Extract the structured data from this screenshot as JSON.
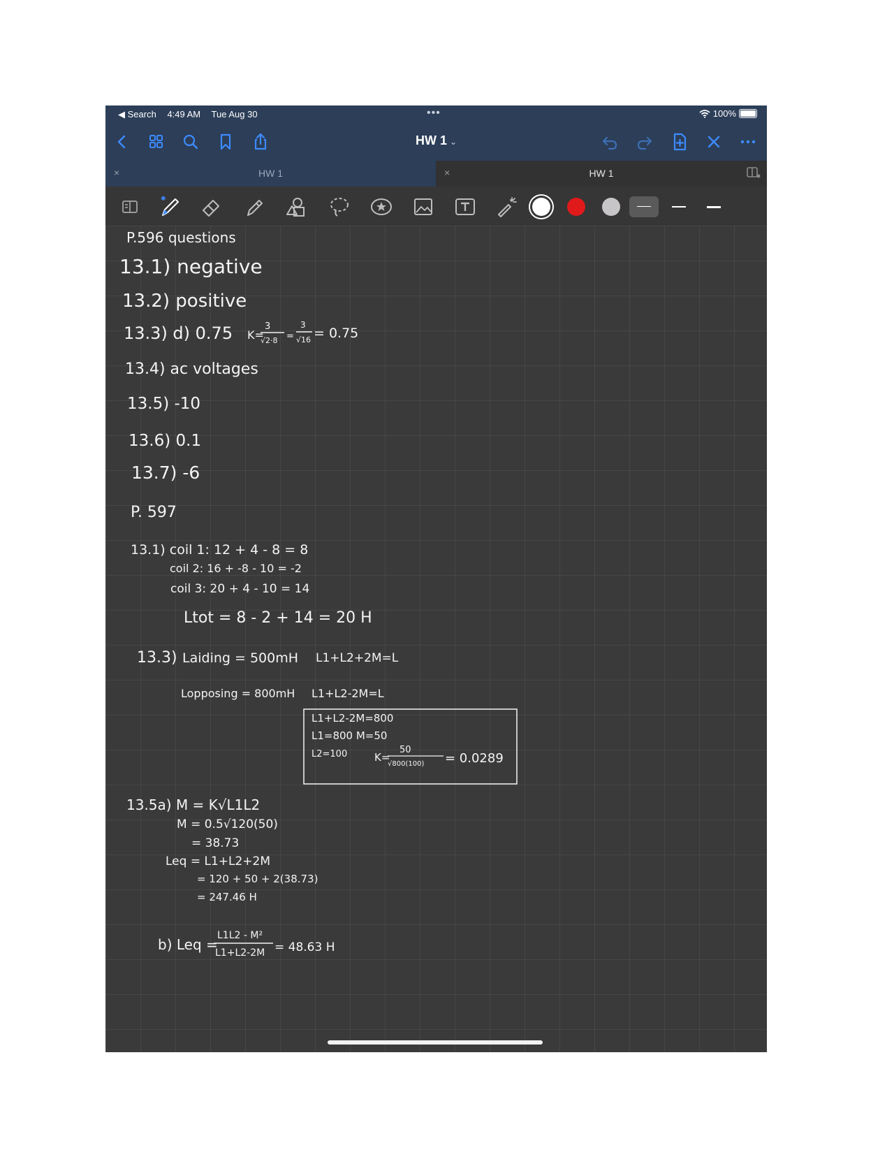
{
  "status_bar": {
    "back_label": "◀ Search",
    "time": "4:49 AM",
    "date": "Tue Aug 30",
    "multitask_dots": "•••",
    "battery": "100%"
  },
  "nav": {
    "title": "HW 1"
  },
  "tabs": [
    {
      "label": "HW 1",
      "close": "×"
    },
    {
      "label": "HW 1",
      "close": "×"
    }
  ],
  "colors": {
    "navy": "#2c3e58",
    "ink_white": "#ffffff",
    "ink_red": "#e0191b",
    "ink_grey": "#c8c5c8"
  },
  "notes": {
    "heading1": "P.596 questions",
    "a1": "13.1) negative",
    "a2": "13.2) positive",
    "a3": "13.3) d) 0.75",
    "a3_k_label": "K=",
    "a3_n1": "3",
    "a3_d1": "√2·8",
    "a3_n2": "3",
    "a3_d2": "√16",
    "a3_result": "= 0.75",
    "a4": "13.4) ac voltages",
    "a5": "13.5) -10",
    "a6": "13.6)  0.1",
    "a7": "13.7) -6",
    "heading2": "P. 597",
    "c1": "13.1)  coil 1:  12 + 4 - 8 = 8",
    "c2": "coil 2:  16 + -8 - 10 = -2",
    "c3": "coil 3:  20 + 4 - 10 = 14",
    "ltot": "Ltot = 8 - 2 + 14 = 20 H",
    "q3_label": "13.3)",
    "q3_aiding": "Laiding = 500mH",
    "q3_aiding_eq": "L1+L2+2M=L",
    "q3_opposing": "Lopposing = 800mH",
    "q3_opposing_eq": "L1+L2-2M=L",
    "box1": "L1+L2-2M=800",
    "box2": "L1=800   M=50",
    "box3": "L2=100",
    "box_k": "K=",
    "box_num": "50",
    "box_den": "√800(100)",
    "box_result": "= 0.0289",
    "s1": "13.5a)  M = K√L1L2",
    "s2": "M = 0.5√120(50)",
    "s3": "= 38.73",
    "s4": "Leq = L1+L2+2M",
    "s5": "= 120 + 50 + 2(38.73)",
    "s6": "= 247.46 H",
    "b_label": "b)  Leq =",
    "b_num": "L1L2 - M²",
    "b_den": "L1+L2-2M",
    "b_result": "= 48.63 H"
  }
}
